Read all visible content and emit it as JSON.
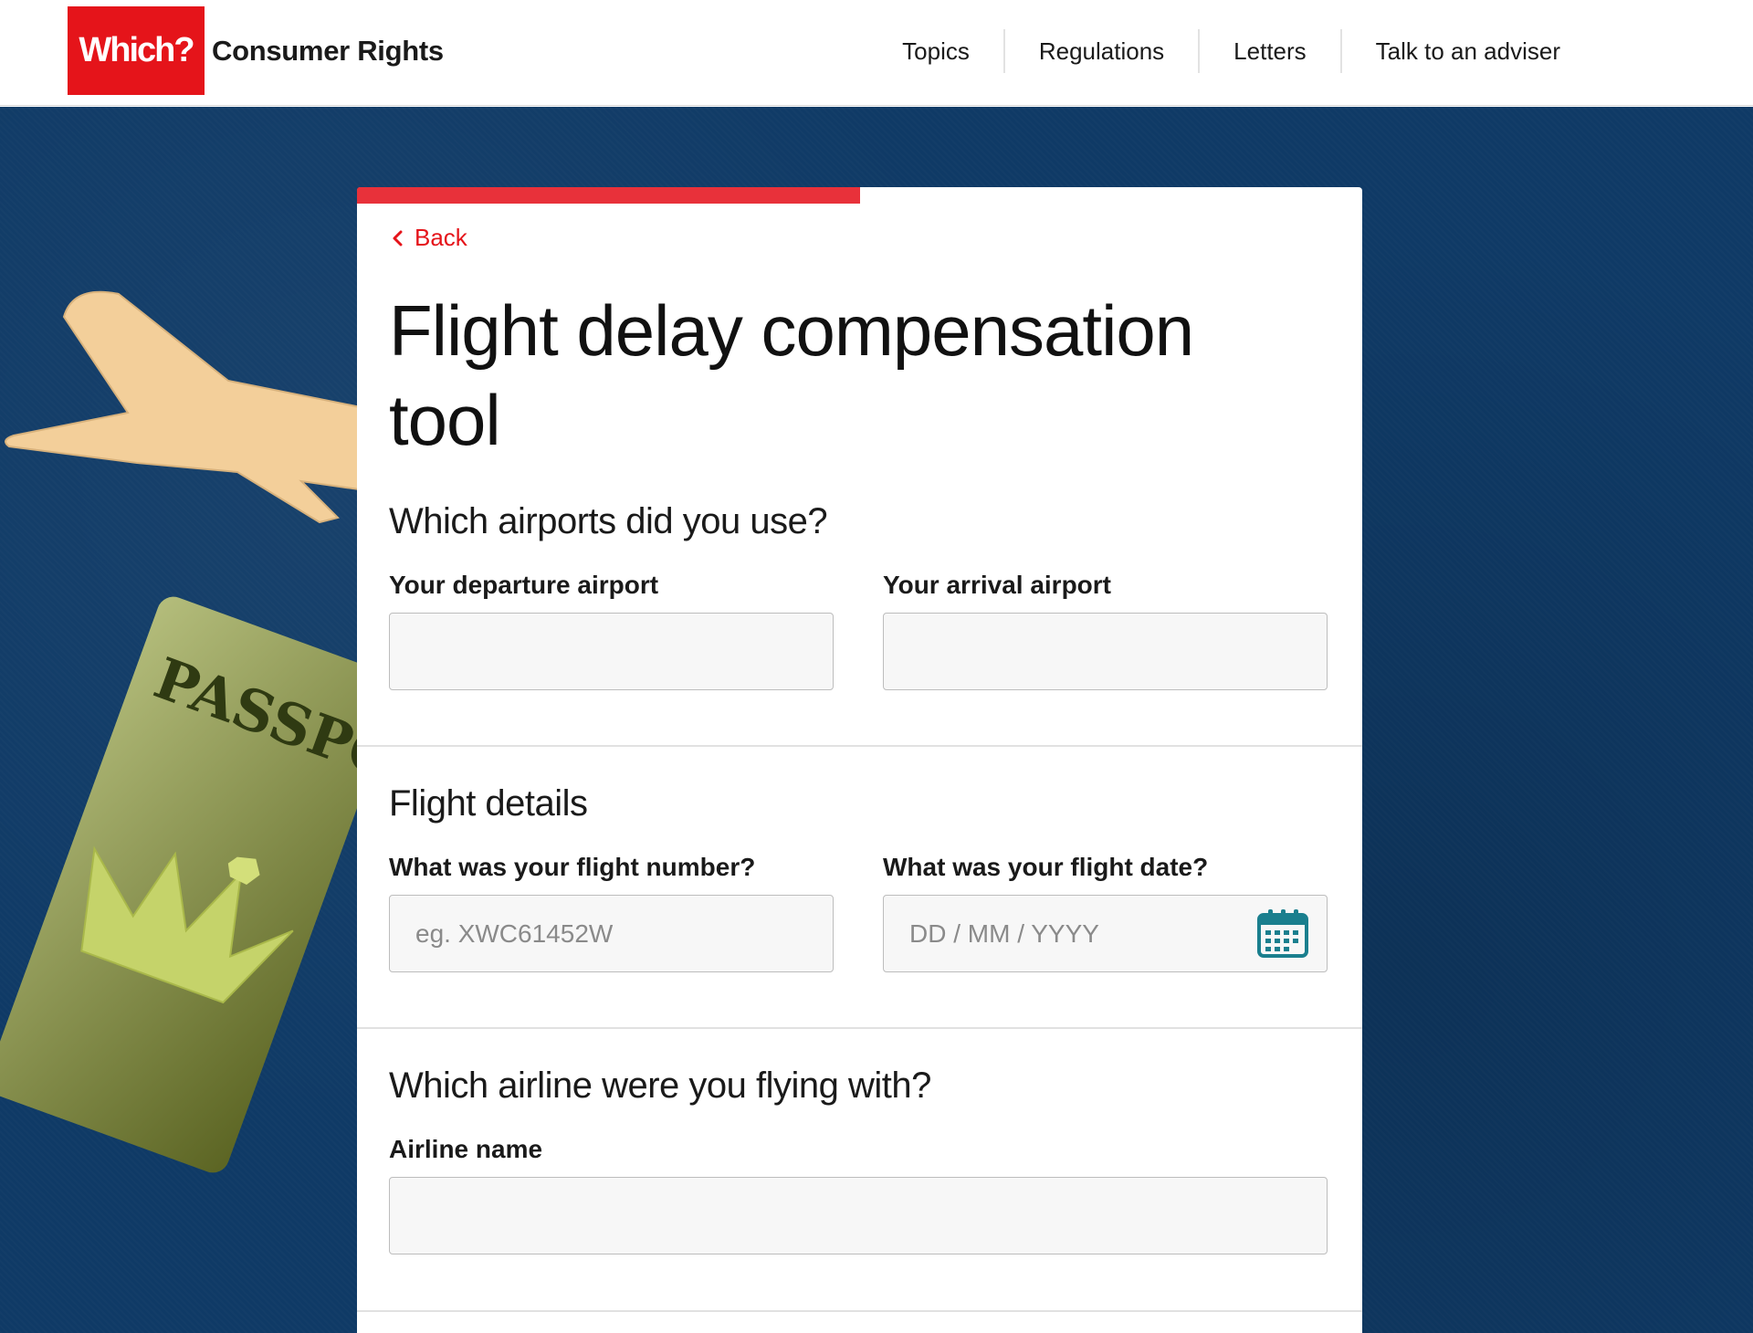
{
  "header": {
    "logo_text": "Which?",
    "brand_name": "Consumer Rights",
    "nav": [
      "Topics",
      "Regulations",
      "Letters",
      "Talk to an adviser"
    ]
  },
  "hero": {
    "passport_text": "PASSPO"
  },
  "form": {
    "progress_fraction": 0.5,
    "back_label": "Back",
    "title": "Flight delay compensation tool",
    "airports": {
      "heading": "Which airports did you use?",
      "departure_label": "Your departure airport",
      "departure_value": "",
      "arrival_label": "Your arrival airport",
      "arrival_value": ""
    },
    "flight": {
      "heading": "Flight details",
      "number_label": "What was your flight number?",
      "number_placeholder": "eg. XWC61452W",
      "date_label": "What was your flight date?",
      "date_placeholder": "DD / MM / YYYY"
    },
    "airline": {
      "heading": "Which airline were you flying with?",
      "name_label": "Airline name",
      "name_value": ""
    }
  },
  "colors": {
    "brand_red": "#e5141a",
    "hero_blue": "#0f3a66",
    "calendar_teal": "#1a7f8e"
  }
}
